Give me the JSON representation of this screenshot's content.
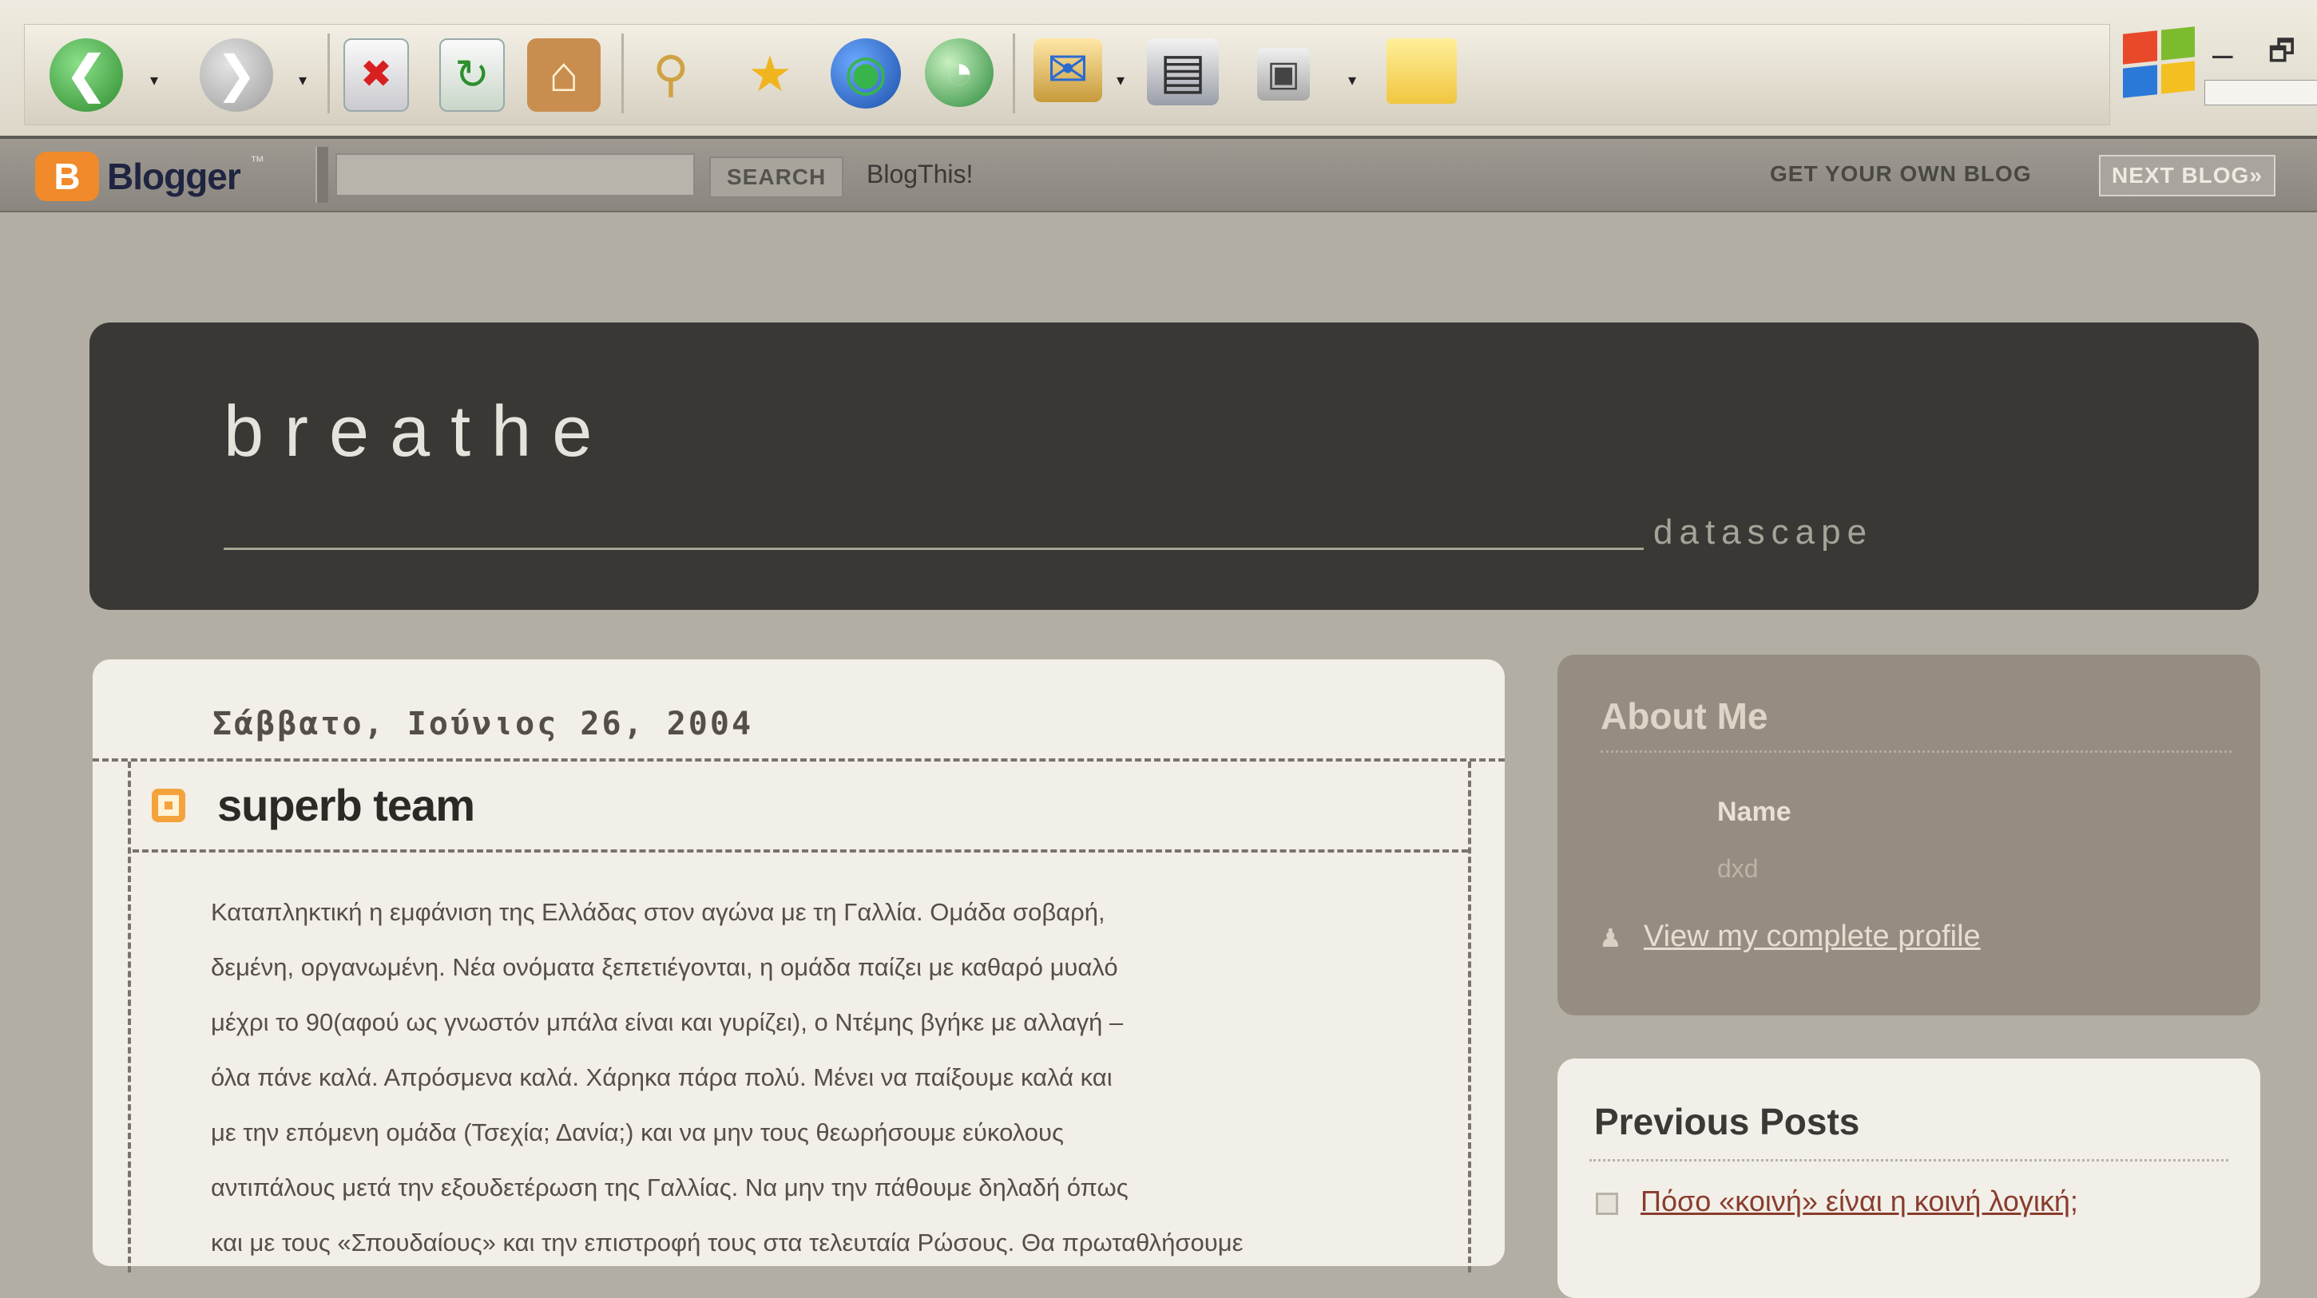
{
  "toolbar": {
    "buttons": [
      {
        "icon": "back-arrow-icon",
        "glyph": "❮"
      },
      {
        "icon": "forward-arrow-icon",
        "glyph": "❯"
      },
      {
        "icon": "stop-icon",
        "glyph": "✖"
      },
      {
        "icon": "refresh-icon",
        "glyph": "↻"
      },
      {
        "icon": "home-icon",
        "glyph": "⌂"
      },
      {
        "icon": "search-icon",
        "glyph": "⚲"
      },
      {
        "icon": "favorites-star-icon",
        "glyph": "★"
      },
      {
        "icon": "media-globe-icon",
        "glyph": "◉"
      },
      {
        "icon": "history-icon",
        "glyph": "◔"
      },
      {
        "icon": "mail-icon",
        "glyph": "✉"
      },
      {
        "icon": "print-icon",
        "glyph": "▤"
      },
      {
        "icon": "edit-icon",
        "glyph": "▣"
      },
      {
        "icon": "note-icon",
        "glyph": ""
      }
    ],
    "window_controls": {
      "minimize": "–",
      "restore": "🗗"
    }
  },
  "navbar": {
    "logo_letter": "B",
    "brand": "Blogger",
    "brand_tm": "™",
    "search_value": "",
    "search_label": "SEARCH",
    "blogthis_label": "BlogThis!",
    "get_own_label": "GET YOUR OWN BLOG",
    "next_label": "NEXT BLOG»"
  },
  "header": {
    "title": "breathe",
    "description": "datascape"
  },
  "post": {
    "date": "Σάββατο, Ιούνιος 26, 2004",
    "title": "superb team",
    "body_lines": [
      "Καταπληκτική η εμφάνιση της Ελλάδας στον αγώνα με τη Γαλλία. Ομάδα σοβαρή,",
      "δεμένη, οργανωμένη. Νέα ονόματα ξεπετιέγονται, η ομάδα παίζει με καθαρό μυαλό",
      "μέχρι το 90(αφού ως γνωστόν μπάλα είναι και γυρίζει), ο Ντέμης βγήκε με αλλαγή –",
      "όλα πάνε καλά. Απρόσμενα καλά. Χάρηκα πάρα πολύ. Μένει να παίξουμε καλά και",
      "με την επόμενη ομάδα (Τσεχία; Δανία;) και να μην τους θεωρήσουμε εύκολους",
      "αντιπάλους μετά την εξουδετέρωση της Γαλλίας. Να μην την πάθουμε δηλαδή όπως",
      "και με τους «Σπουδαίους» και την επιστροφή τους στα τελευταία Ρώσους. Θα πρωταθλήσουμε"
    ]
  },
  "about": {
    "title": "About Me",
    "name_label": "Name",
    "name_value": "dxd",
    "profile_link": "View my complete profile"
  },
  "previous": {
    "title": "Previous Posts",
    "links": [
      "Πόσο «κοινή» είναι η κοινή λογική;"
    ]
  },
  "colors": {
    "page_bg": "#b3aea3",
    "header_bg": "#3a3835",
    "card_bg": "#f1efe8",
    "about_bg": "#968d82",
    "post_bullet": "#f4a33c",
    "link_red": "#8a3c2d"
  }
}
